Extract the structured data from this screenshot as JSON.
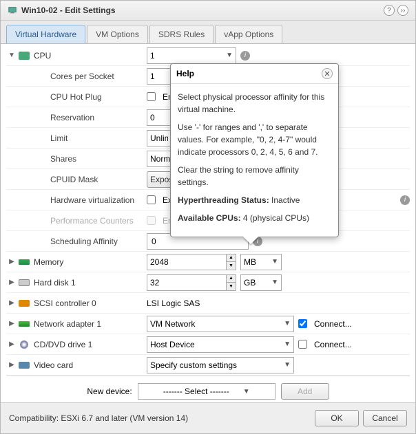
{
  "title": "Win10-02 - Edit Settings",
  "tabs": [
    "Virtual Hardware",
    "VM Options",
    "SDRS Rules",
    "vApp Options"
  ],
  "cpu": {
    "label": "CPU",
    "count": "1",
    "cores_label": "Cores per Socket",
    "cores": "1",
    "hotplug_label": "CPU Hot Plug",
    "hotplug_cb": "Enabl",
    "reservation_label": "Reservation",
    "reservation": "0",
    "limit_label": "Limit",
    "limit": "Unlimite",
    "shares_label": "Shares",
    "shares": "Normal",
    "cpuid_label": "CPUID Mask",
    "cpuid": "Expose",
    "hwvirt_label": "Hardware virtualization",
    "hwvirt_cb": "Expos",
    "perf_label": "Performance Counters",
    "perf_cb": "Enabl",
    "affinity_label": "Scheduling Affinity",
    "affinity": "0"
  },
  "memory": {
    "label": "Memory",
    "size": "2048",
    "unit": "MB"
  },
  "disk": {
    "label": "Hard disk 1",
    "size": "32",
    "unit": "GB"
  },
  "scsi": {
    "label": "SCSI controller 0",
    "adapter": "LSI Logic SAS"
  },
  "net": {
    "label": "Network adapter 1",
    "value": "VM Network",
    "connect": "Connect..."
  },
  "cd": {
    "label": "CD/DVD drive 1",
    "value": "Host Device",
    "connect": "Connect..."
  },
  "video": {
    "label": "Video card",
    "value": "Specify custom settings"
  },
  "newdev": {
    "label": "New device:",
    "select": "------- Select -------",
    "add": "Add"
  },
  "compat": "Compatibility: ESXi 6.7 and later (VM version 14)",
  "ok": "OK",
  "cancel": "Cancel",
  "help": {
    "title": "Help",
    "p1": "Select physical processor affinity for this virtual machine.",
    "p2": "Use '-' for ranges and ',' to separate values. For example, \"0, 2, 4-7\" would indicate processors 0, 2, 4, 5, 6 and 7.",
    "p3": "Clear the string to remove affinity settings.",
    "ht_label": "Hyperthreading Status:",
    "ht_val": " Inactive",
    "cpu_label": "Available CPUs:",
    "cpu_val": " 4 (physical CPUs)"
  }
}
